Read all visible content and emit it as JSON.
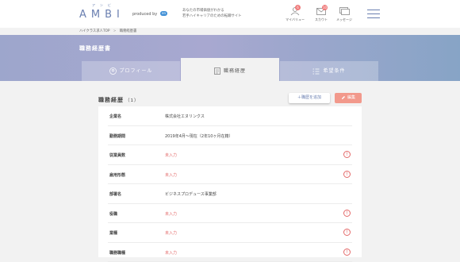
{
  "header": {
    "logo_ruby": "アンビ",
    "logo": "AMBI",
    "produced_by": "produced by",
    "produced_badge": "en",
    "tagline_1": "あなたの市場価値がわかる",
    "tagline_2": "若手ハイキャリアのための転職サイト",
    "nav": [
      {
        "label": "マイバリュー",
        "badge": "6",
        "icon": "person-icon"
      },
      {
        "label": "スカウト",
        "badge": "10",
        "icon": "mail-icon"
      },
      {
        "label": "メッセージ",
        "badge": "",
        "icon": "message-icon"
      }
    ]
  },
  "breadcrumb": {
    "home": "ハイクラス求人TOP",
    "current": "職務経歴書"
  },
  "page_title": "職務経歴書",
  "tabs": [
    {
      "label": "プロフィール",
      "icon": "profile-icon",
      "active": false
    },
    {
      "label": "職務経歴",
      "icon": "document-icon",
      "active": true
    },
    {
      "label": "希望条件",
      "icon": "list-icon",
      "active": false
    }
  ],
  "section": {
    "title": "職務経歴",
    "count": "（1）",
    "add_label": "＋職歴を追加",
    "edit_label": "編集"
  },
  "rows": [
    {
      "label": "企業名",
      "value": "株式会社エヌリンクス",
      "missing": false
    },
    {
      "label": "勤務期間",
      "value": "2019年4月〜現在（2年10ヶ月在籍）",
      "missing": false
    },
    {
      "label": "従業員数",
      "value": "未入力",
      "missing": true
    },
    {
      "label": "雇用形態",
      "value": "未入力",
      "missing": true
    },
    {
      "label": "部署名",
      "value": "ビジネスプロデュース事業部",
      "missing": false
    },
    {
      "label": "役職",
      "value": "未入力",
      "missing": true
    },
    {
      "label": "業種",
      "value": "未入力",
      "missing": true
    },
    {
      "label": "職務職種",
      "value": "未入力",
      "missing": true
    }
  ],
  "colors": {
    "accent": "#6a7fb0",
    "warning": "#e46a6a",
    "edit_button": "#f2998c"
  }
}
